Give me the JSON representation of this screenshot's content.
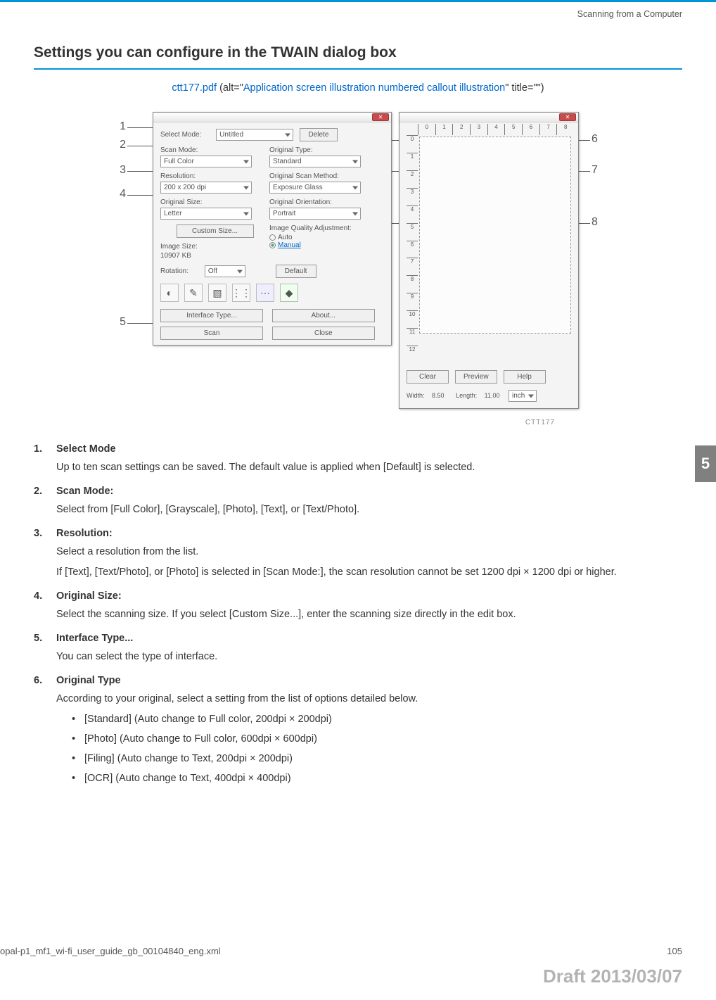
{
  "header": {
    "running": "Scanning from a Computer"
  },
  "section": {
    "title": "Settings you can configure in the TWAIN dialog box"
  },
  "alt_line": {
    "file": "ctt177.pdf",
    "open": " (alt=\"",
    "alt_text": "Application screen illustration numbered callout illustration",
    "close": "\" title=\"\")"
  },
  "callouts": {
    "c1": "1",
    "c2": "2",
    "c3": "3",
    "c4": "4",
    "c5": "5",
    "c6": "6",
    "c7": "7",
    "c8": "8"
  },
  "dialog_left": {
    "select_mode_label": "Select Mode:",
    "select_mode_value": "Untitled",
    "delete_btn": "Delete",
    "scan_mode_label": "Scan Mode:",
    "scan_mode_value": "Full Color",
    "resolution_label": "Resolution:",
    "resolution_value": "200 x 200 dpi",
    "original_size_label": "Original Size:",
    "original_size_value": "Letter",
    "custom_size_btn": "Custom Size...",
    "image_size_label": "Image Size:",
    "image_size_value": "10907 KB",
    "original_type_label": "Original Type:",
    "original_type_value": "Standard",
    "scan_method_label": "Original Scan Method:",
    "scan_method_value": "Exposure Glass",
    "orientation_label": "Original Orientation:",
    "orientation_value": "Portrait",
    "iqa_label": "Image Quality Adjustment:",
    "iqa_auto": "Auto",
    "iqa_manual": "Manual",
    "rotation_label": "Rotation:",
    "rotation_value": "Off",
    "default_btn": "Default",
    "interface_btn": "Interface Type...",
    "about_btn": "About...",
    "scan_btn": "Scan",
    "close_btn": "Close"
  },
  "dialog_right": {
    "ruler_h": [
      "0",
      "1",
      "2",
      "3",
      "4",
      "5",
      "6",
      "7",
      "8"
    ],
    "ruler_v": [
      "0",
      "1",
      "2",
      "3",
      "4",
      "5",
      "6",
      "7",
      "8",
      "9",
      "10",
      "11",
      "12"
    ],
    "clear_btn": "Clear",
    "preview_btn": "Preview",
    "help_btn": "Help",
    "width_label": "Width:",
    "width_val": "8.50",
    "length_label": "Length:",
    "length_val": "11.00",
    "unit": "inch"
  },
  "figure": {
    "caption": "CTT177"
  },
  "definitions": [
    {
      "term": "Select Mode",
      "paras": [
        "Up to ten scan settings can be saved. The default value is applied when [Default] is selected."
      ]
    },
    {
      "term": "Scan Mode:",
      "paras": [
        "Select from [Full Color], [Grayscale], [Photo], [Text], or [Text/Photo]."
      ]
    },
    {
      "term": "Resolution:",
      "paras": [
        "Select a resolution from the list.",
        "If [Text], [Text/Photo], or [Photo] is selected in [Scan Mode:], the scan resolution cannot be set 1200 dpi × 1200 dpi or higher."
      ]
    },
    {
      "term": "Original Size:",
      "paras": [
        "Select the scanning size. If you select [Custom Size...], enter the scanning size directly in the edit box."
      ]
    },
    {
      "term": "Interface Type...",
      "paras": [
        "You can select the type of interface."
      ]
    },
    {
      "term": "Original Type",
      "paras": [
        "According to your original, select a setting from the list of options detailed below."
      ],
      "bullets": [
        "[Standard] (Auto change to Full color, 200dpi × 200dpi)",
        "[Photo] (Auto change to Full color, 600dpi × 600dpi)",
        "[Filing] (Auto change to Text, 200dpi × 200dpi)",
        "[OCR] (Auto change to Text, 400dpi × 400dpi)"
      ]
    }
  ],
  "side_tab": "5",
  "footer": {
    "file": "opal-p1_mf1_wi-fi_user_guide_gb_00104840_eng.xml",
    "page": "105"
  },
  "draft": "Draft 2013/03/07"
}
